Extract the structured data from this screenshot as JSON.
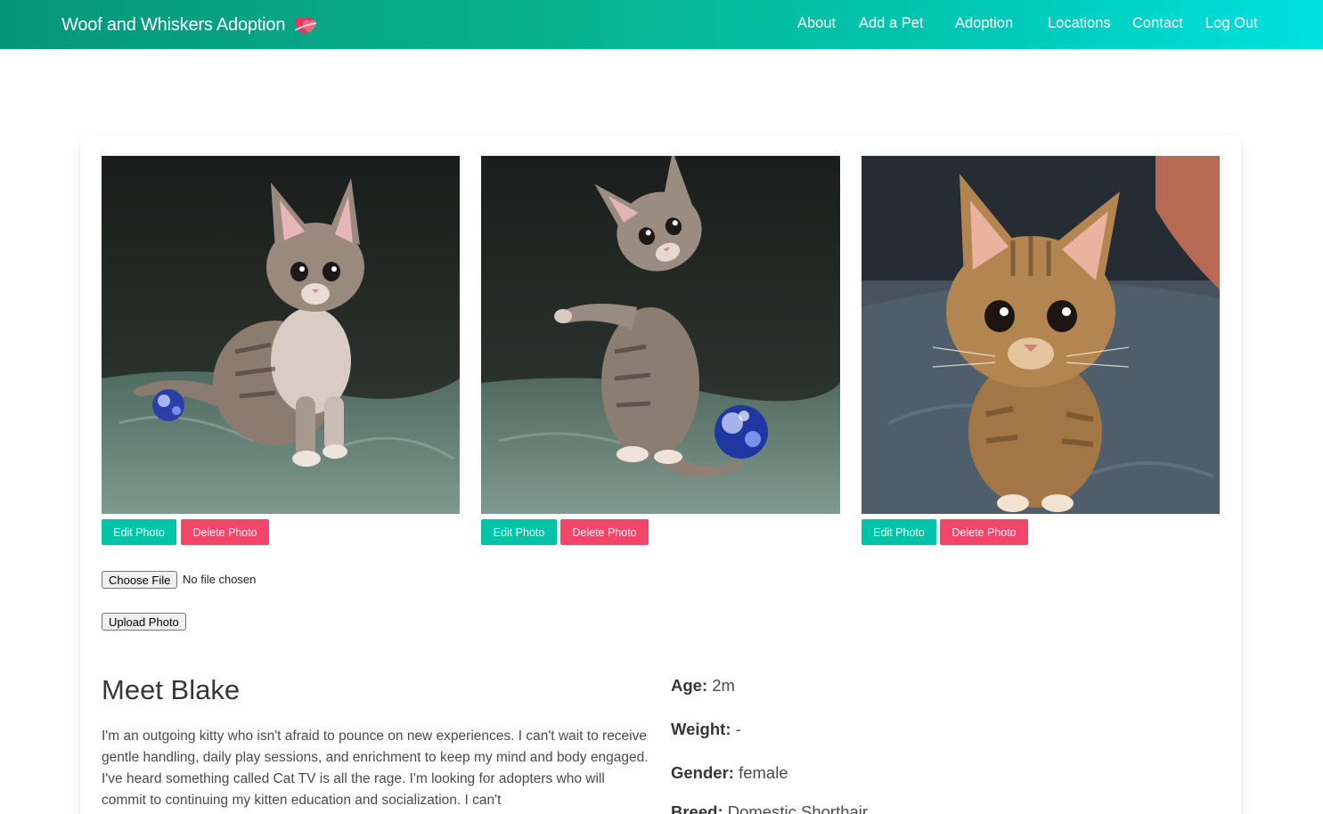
{
  "navbar": {
    "brand": "Woof and Whiskers Adoption",
    "links": [
      "About",
      "Add a Pet",
      "Adoption",
      "Locations",
      "Contact",
      "Log Out"
    ]
  },
  "photos": [
    {
      "edit_label": "Edit Photo",
      "delete_label": "Delete Photo"
    },
    {
      "edit_label": "Edit Photo",
      "delete_label": "Delete Photo"
    },
    {
      "edit_label": "Edit Photo",
      "delete_label": "Delete Photo"
    }
  ],
  "upload": {
    "choose_label": "Choose File",
    "file_status": "No file chosen",
    "upload_label": "Upload Photo"
  },
  "pet": {
    "title": "Meet Blake",
    "bio": "I'm an outgoing kitty who isn't afraid to pounce on new experiences. I can't wait to receive gentle handling, daily play sessions, and enrichment to keep my mind and body engaged. I've heard something called Cat TV is all the rage. I'm looking for adopters who will commit to continuing my kitten education and socialization. I can't",
    "facts": [
      {
        "label": "Age:",
        "value": "2m"
      },
      {
        "label": "Weight:",
        "value": "-"
      },
      {
        "label": "Gender:",
        "value": "female"
      },
      {
        "label": "Breed:",
        "value": "Domestic Shorthair"
      }
    ]
  },
  "colors": {
    "nav_start": "#05957a",
    "nav_end": "#00e1e1",
    "edit_button": "#00c4a7",
    "delete_button": "#f14668"
  },
  "icons": {
    "brand": "heart-icon"
  }
}
